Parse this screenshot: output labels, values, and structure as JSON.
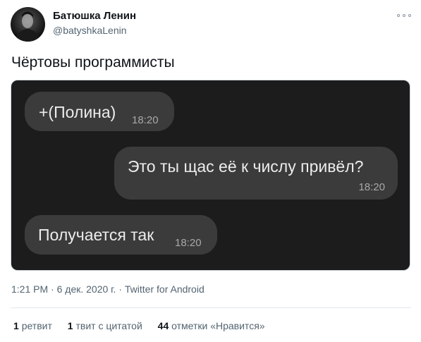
{
  "author": {
    "display_name": "Батюшка Ленин",
    "handle": "@batyshkaLenin"
  },
  "tweet": {
    "text": "Чёртовы программисты"
  },
  "media": {
    "messages": [
      {
        "text": "+(Полина)",
        "time": "18:20",
        "side": "left"
      },
      {
        "text": "Это ты щас её к числу привёл?",
        "time": "18:20",
        "side": "right"
      },
      {
        "text": "Получается так",
        "time": "18:20",
        "side": "left"
      }
    ]
  },
  "meta": {
    "time": "1:21 PM",
    "separator": " · ",
    "date": "6 дек. 2020 г.",
    "source": "Twitter for Android"
  },
  "stats": {
    "retweets_count": "1",
    "retweets_label": "ретвит",
    "quotes_count": "1",
    "quotes_label": "твит с цитатой",
    "likes_count": "44",
    "likes_label": "отметки «Нравится»"
  },
  "colors": {
    "media_bg": "#1c1c1c",
    "bubble_bg": "#3b3b3b",
    "secondary_text": "#536471"
  },
  "icons": [
    "avatar",
    "more-icon"
  ]
}
